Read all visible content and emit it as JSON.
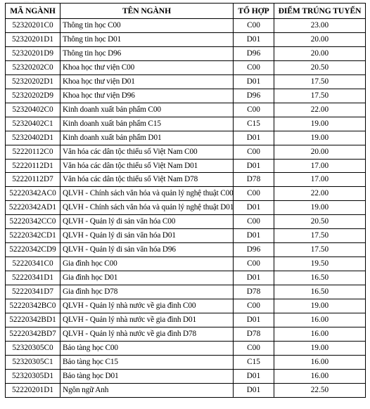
{
  "document": {
    "artifact_text": "— -",
    "table": {
      "name": "bang-diem-trung-tuyen",
      "columns": [
        {
          "key": "code",
          "label": "MÃ NGÀNH"
        },
        {
          "key": "name",
          "label": "TÊN NGÀNH"
        },
        {
          "key": "group",
          "label": "TỔ HỢP"
        },
        {
          "key": "score",
          "label": "ĐIỂM TRÚNG TUYỂN"
        }
      ],
      "rows": [
        {
          "code": "52320201C0",
          "name": "Thông tin học C00",
          "group": "C00",
          "score": "23.00"
        },
        {
          "code": "52320201D1",
          "name": "Thông tin học D01",
          "group": "D01",
          "score": "20.00"
        },
        {
          "code": "52320201D9",
          "name": "Thông tin học D96",
          "group": "D96",
          "score": "20.00"
        },
        {
          "code": "52320202C0",
          "name": "Khoa học thư viện C00",
          "group": "C00",
          "score": "20.50"
        },
        {
          "code": "52320202D1",
          "name": "Khoa học thư viện D01",
          "group": "D01",
          "score": "17.50"
        },
        {
          "code": "52320202D9",
          "name": "Khoa học thư viện D96",
          "group": "D96",
          "score": "17.50"
        },
        {
          "code": "52320402C0",
          "name": "Kinh doanh xuất bản phẩm C00",
          "group": "C00",
          "score": "22.00"
        },
        {
          "code": "52320402C1",
          "name": "Kinh doanh xuất bản phẩm C15",
          "group": "C15",
          "score": "19.00"
        },
        {
          "code": "52320402D1",
          "name": "Kinh doanh xuất bản phẩm D01",
          "group": "D01",
          "score": "19.00"
        },
        {
          "code": "52220112C0",
          "name": "Văn hóa các dân tộc thiểu số Việt Nam C00",
          "group": "C00",
          "score": "20.00"
        },
        {
          "code": "52220112D1",
          "name": "Văn hóa các dân tộc thiểu số Việt Nam D01",
          "group": "D01",
          "score": "17.00"
        },
        {
          "code": "52220112D7",
          "name": "Văn hóa các dân tộc thiểu số Việt Nam D78",
          "group": "D78",
          "score": "17.00"
        },
        {
          "code": "52220342AC0",
          "name": "QLVH - Chính sách văn hóa và quản lý nghệ thuật C00",
          "group": "C00",
          "score": "22.00"
        },
        {
          "code": "52220342AD1",
          "name": "QLVH - Chính sách văn hóa và quản lý nghệ thuật D01",
          "group": "D01",
          "score": "19.00"
        },
        {
          "code": "52220342CC0",
          "name": "QLVH - Quản lý di sản văn hóa C00",
          "group": "C00",
          "score": "20.50"
        },
        {
          "code": "52220342CD1",
          "name": "QLVH - Quản lý di sản văn hóa D01",
          "group": "D01",
          "score": "17.50"
        },
        {
          "code": "52220342CD9",
          "name": "QLVH - Quản lý di sản văn hóa D96",
          "group": "D96",
          "score": "17.50"
        },
        {
          "code": "52220341C0",
          "name": "Gia đình học C00",
          "group": "C00",
          "score": "19.50"
        },
        {
          "code": "52220341D1",
          "name": "Gia đình học D01",
          "group": "D01",
          "score": "16.50"
        },
        {
          "code": "52220341D7",
          "name": "Gia đình học D78",
          "group": "D78",
          "score": "16.50"
        },
        {
          "code": "52220342BC0",
          "name": "QLVH - Quản lý nhà nước về gia đình C00",
          "group": "C00",
          "score": "19.00"
        },
        {
          "code": "52220342BD1",
          "name": "QLVH - Quản lý nhà nước về gia đình D01",
          "group": "D01",
          "score": "16.00"
        },
        {
          "code": "52220342BD7",
          "name": "QLVH - Quản lý nhà nước về gia đình D78",
          "group": "D78",
          "score": "16.00"
        },
        {
          "code": "52320305C0",
          "name": "Bảo tàng học C00",
          "group": "C00",
          "score": "19.00"
        },
        {
          "code": "52320305C1",
          "name": "Bảo tàng học C15",
          "group": "C15",
          "score": "16.00"
        },
        {
          "code": "52320305D1",
          "name": "Bảo tàng học D01",
          "group": "D01",
          "score": "16.00"
        },
        {
          "code": "52220201D1",
          "name": "Ngôn ngữ Anh",
          "group": "D01",
          "score": "22.50"
        }
      ]
    }
  }
}
